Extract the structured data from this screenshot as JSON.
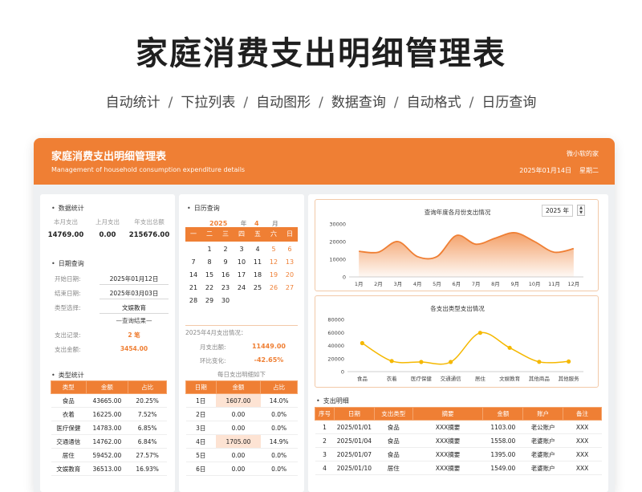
{
  "hero": {
    "title": "家庭消费支出明细管理表",
    "features": [
      "自动统计",
      "下拉列表",
      "自动图形",
      "数据查询",
      "自动格式",
      "日历查询"
    ]
  },
  "window": {
    "title": "家庭消费支出明细管理表",
    "subtitle": "Management of household consumption expenditure details",
    "user": "微小软的家",
    "date": "2025年01月14日",
    "weekday": "星期二"
  },
  "stats": {
    "title": "数据统计",
    "headers": [
      "本月支出",
      "上月支出",
      "年支出总额"
    ],
    "values": [
      "14769.00",
      "0.00",
      "215676.00"
    ]
  },
  "date_query": {
    "title": "日期查询",
    "start_label": "开始日期:",
    "start_value": "2025年01月12日",
    "end_label": "结束日期:",
    "end_value": "2025年03月03日",
    "type_label": "类型选择:",
    "type_value": "文娱教育",
    "result_header": "—查询结果—",
    "records_label": "支出记录:",
    "records_value": "2 笔",
    "amount_label": "支出金额:",
    "amount_value": "3454.00"
  },
  "category_stats": {
    "title": "类型统计",
    "columns": [
      "类型",
      "金额",
      "占比"
    ],
    "rows": [
      [
        "食品",
        "43665.00",
        "20.25%"
      ],
      [
        "衣着",
        "16225.00",
        "7.52%"
      ],
      [
        "医疗保健",
        "14783.00",
        "6.85%"
      ],
      [
        "交通通信",
        "14762.00",
        "6.84%"
      ],
      [
        "居住",
        "59452.00",
        "27.57%"
      ],
      [
        "文娱教育",
        "36513.00",
        "16.93%"
      ]
    ]
  },
  "calendar": {
    "title": "日历查询",
    "year": "2025",
    "year_unit": "年",
    "month": "4",
    "month_unit": "月",
    "weekdays": [
      "一",
      "二",
      "三",
      "四",
      "五",
      "六",
      "日"
    ],
    "leading_blanks": 1,
    "days": 30
  },
  "month_summary": {
    "title": "2025年4月支出情况：",
    "total_label": "月支出额:",
    "total_value": "11449.00",
    "change_label": "环比变化:",
    "change_value": "-42.65%",
    "daily_title": "每日支出明细如下",
    "columns": [
      "日期",
      "金额",
      "占比"
    ],
    "rows": [
      [
        "1日",
        "1607.00",
        "14.0%"
      ],
      [
        "2日",
        "0.00",
        "0.0%"
      ],
      [
        "3日",
        "0.00",
        "0.0%"
      ],
      [
        "4日",
        "1705.00",
        "14.9%"
      ],
      [
        "5日",
        "0.00",
        "0.0%"
      ],
      [
        "6日",
        "0.00",
        "0.0%"
      ]
    ]
  },
  "detail": {
    "title": "支出明细",
    "columns": [
      "序号",
      "日期",
      "支出类型",
      "摘要",
      "金额",
      "账户",
      "备注"
    ],
    "rows": [
      [
        "1",
        "2025/01/01",
        "食品",
        "XXX摘要",
        "1103.00",
        "老公账户",
        "XXX"
      ],
      [
        "2",
        "2025/01/04",
        "食品",
        "XXX摘要",
        "1558.00",
        "老婆账户",
        "XXX"
      ],
      [
        "3",
        "2025/01/07",
        "食品",
        "XXX摘要",
        "1395.00",
        "老婆账户",
        "XXX"
      ],
      [
        "4",
        "2025/01/10",
        "居住",
        "XXX摘要",
        "1549.00",
        "老婆账户",
        "XXX"
      ]
    ]
  },
  "chart_data": [
    {
      "type": "area",
      "title": "查询年度各月份支出情况",
      "year_select": "2025 年",
      "stepper_up": "▲",
      "stepper_down": "▼",
      "categories": [
        "1月",
        "2月",
        "3月",
        "4月",
        "5月",
        "6月",
        "7月",
        "8月",
        "9月",
        "10月",
        "11月",
        "12月"
      ],
      "values": [
        14500,
        14000,
        20000,
        11500,
        11500,
        23500,
        18500,
        22000,
        25000,
        20000,
        14000,
        16000
      ],
      "ylim": [
        0,
        30000
      ],
      "yticks": [
        "0",
        "10000",
        "20000",
        "30000"
      ],
      "color": "#ef7f34"
    },
    {
      "type": "line",
      "title": "各支出类型支出情况",
      "categories": [
        "食品",
        "衣着",
        "医疗保健",
        "交通通信",
        "居住",
        "文娱教育",
        "其他商品",
        "其他服务"
      ],
      "values": [
        43665,
        16225,
        14783,
        14762,
        59452,
        36513,
        15000,
        15500
      ],
      "ylim": [
        0,
        80000
      ],
      "yticks": [
        "0",
        "20000",
        "40000",
        "60000",
        "80000"
      ],
      "color": "#f5b800"
    }
  ]
}
